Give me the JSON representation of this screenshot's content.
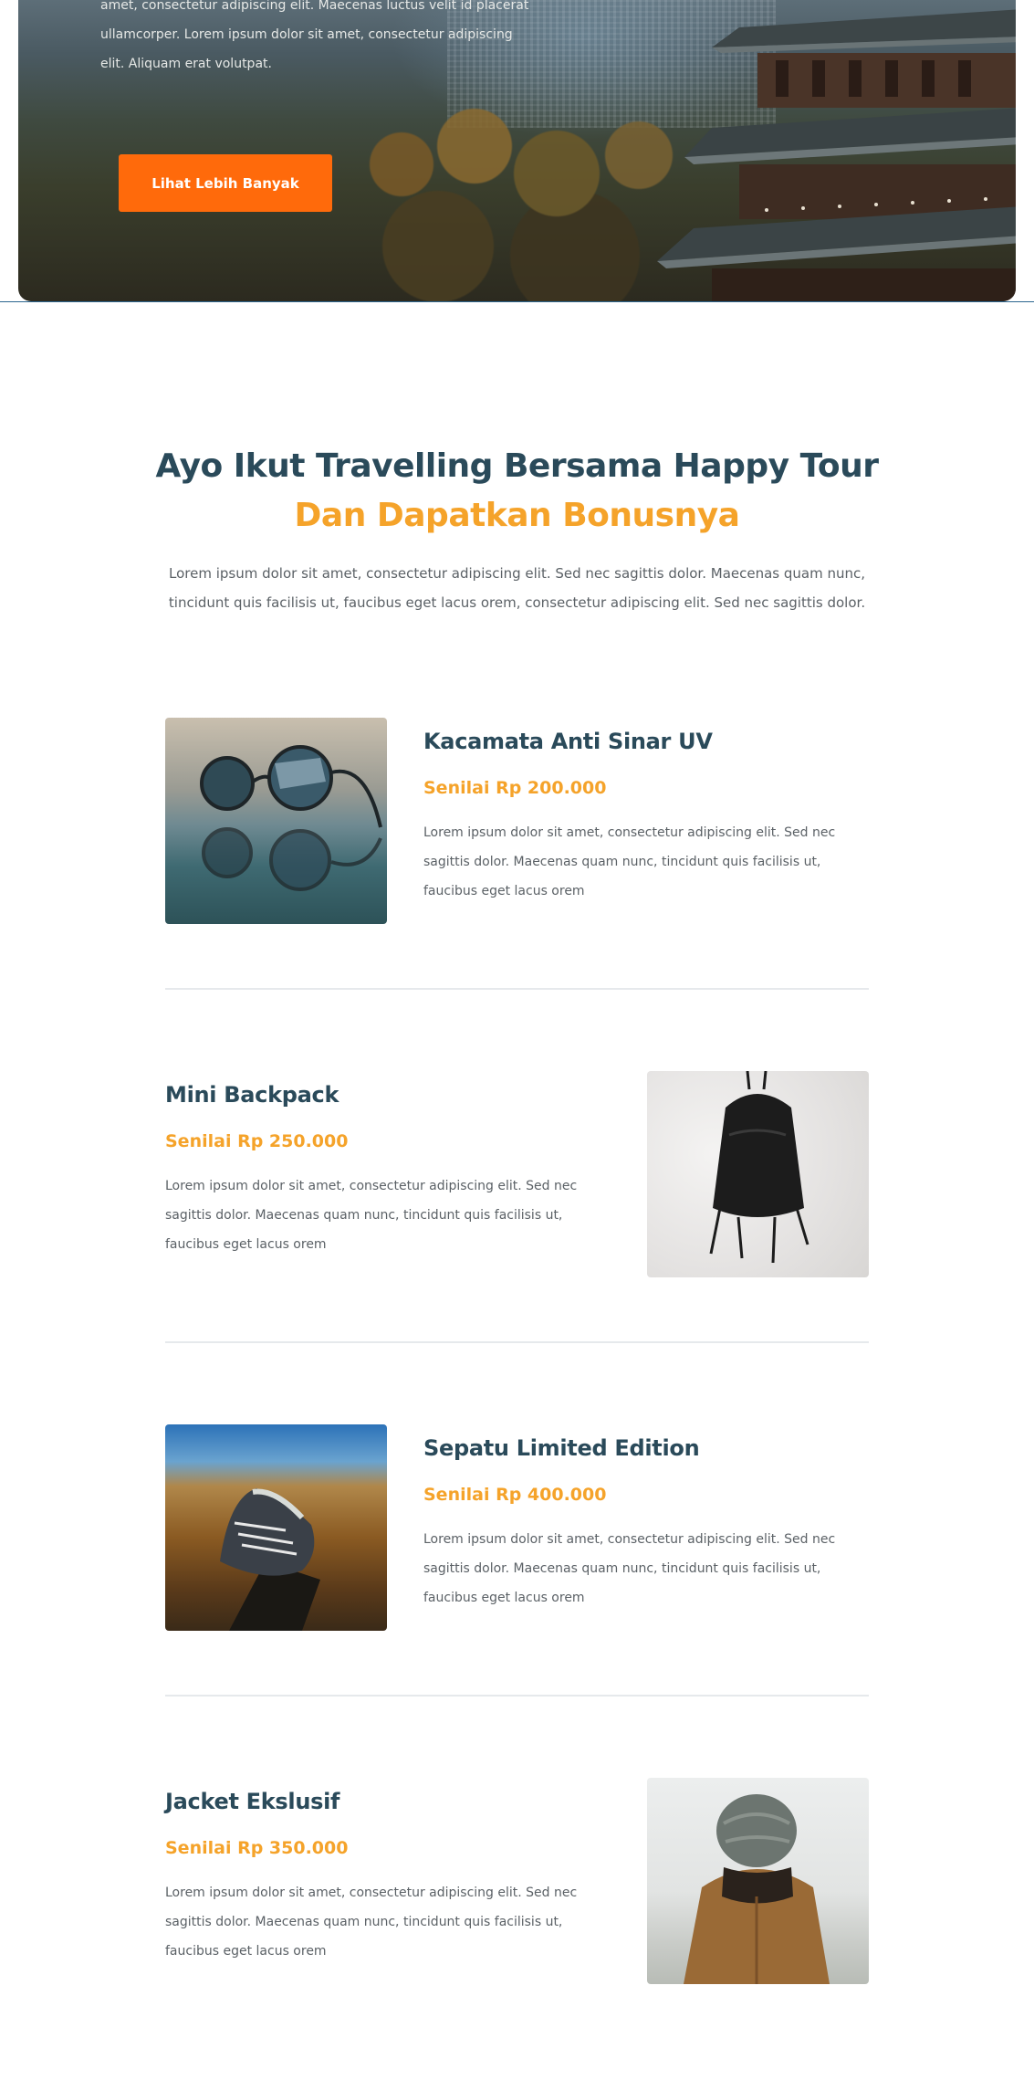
{
  "hero": {
    "text": "amet, consectetur adipiscing elit. Maecenas luctus velit id placerat ullamcorper. Lorem ipsum dolor sit amet, consectetur adipiscing elit. Aliquam erat volutpat.",
    "button_label": "Lihat Lebih Banyak",
    "button_color": "#ff6a0b"
  },
  "section": {
    "title_line1": "Ayo Ikut Travelling Bersama Happy Tour",
    "title_line2": "Dan Dapatkan Bonusnya",
    "description": "Lorem ipsum dolor sit amet, consectetur adipiscing elit. Sed nec sagittis dolor. Maecenas quam nunc, tincidunt quis facilisis ut, faucibus eget lacus orem, consectetur adipiscing elit. Sed nec sagittis dolor.",
    "title_color": "#2a4a5a",
    "accent_color": "#f5a32a"
  },
  "products": [
    {
      "name": "Kacamata Anti Sinar UV",
      "price": "Senilai Rp 200.000",
      "description": "Lorem ipsum dolor sit amet, consectetur adipiscing elit. Sed nec sagittis dolor. Maecenas quam nunc, tincidunt quis facilisis ut, faucibus eget lacus orem",
      "image": "sunglasses-image"
    },
    {
      "name": "Mini Backpack",
      "price": "Senilai Rp 250.000",
      "description": "Lorem ipsum dolor sit amet, consectetur adipiscing elit. Sed nec sagittis dolor. Maecenas quam nunc, tincidunt quis facilisis ut, faucibus eget lacus orem",
      "image": "backpack-image"
    },
    {
      "name": "Sepatu Limited Edition",
      "price": "Senilai Rp 400.000",
      "description": "Lorem ipsum dolor sit amet, consectetur adipiscing elit. Sed nec sagittis dolor. Maecenas quam nunc, tincidunt quis facilisis ut, faucibus eget lacus orem",
      "image": "sneakers-image"
    },
    {
      "name": "Jacket Ekslusif",
      "price": "Senilai Rp 350.000",
      "description": "Lorem ipsum dolor sit amet, consectetur adipiscing elit. Sed nec sagittis dolor. Maecenas quam nunc, tincidunt quis facilisis ut, faucibus eget lacus orem",
      "image": "jacket-image"
    }
  ]
}
